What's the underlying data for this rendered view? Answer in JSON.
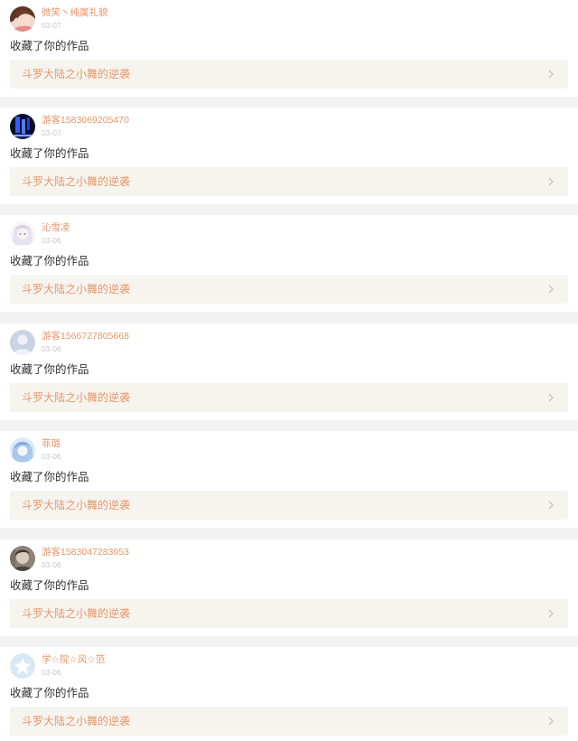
{
  "notifications": [
    {
      "user": "微笑丶纯属礼貌",
      "date": "03-07",
      "action": "收藏了你的作品",
      "work_title": "斗罗大陆之小舞的逆袭",
      "avatar_icon": "girl-photo-avatar"
    },
    {
      "user": "游客1583069205470",
      "date": "03-07",
      "action": "收藏了你的作品",
      "work_title": "斗罗大陆之小舞的逆袭",
      "avatar_icon": "blue-dark-avatar"
    },
    {
      "user": "沁雪凌",
      "date": "03-06",
      "action": "收藏了你的作品",
      "work_title": "斗罗大陆之小舞的逆袭",
      "avatar_icon": "anime-girl-avatar"
    },
    {
      "user": "游客1566727805668",
      "date": "03-06",
      "action": "收藏了你的作品",
      "work_title": "斗罗大陆之小舞的逆袭",
      "avatar_icon": "default-user-avatar"
    },
    {
      "user": "菲璐",
      "date": "03-06",
      "action": "收藏了你的作品",
      "work_title": "斗罗大陆之小舞的逆袭",
      "avatar_icon": "anime-blue-avatar"
    },
    {
      "user": "游客1583047283953",
      "date": "03-06",
      "action": "收藏了你的作品",
      "work_title": "斗罗大陆之小舞的逆袭",
      "avatar_icon": "photo-avatar"
    },
    {
      "user": "学☆院☆风☆范",
      "date": "03-06",
      "action": "收藏了你的作品",
      "work_title": "斗罗大陆之小舞的逆袭",
      "avatar_icon": "star-avatar"
    }
  ],
  "colors": {
    "accent": "#e8976a",
    "date": "#c8c8c8",
    "text": "#333333",
    "link_bg": "#f5f4ef",
    "divider": "#f2f2f2"
  }
}
